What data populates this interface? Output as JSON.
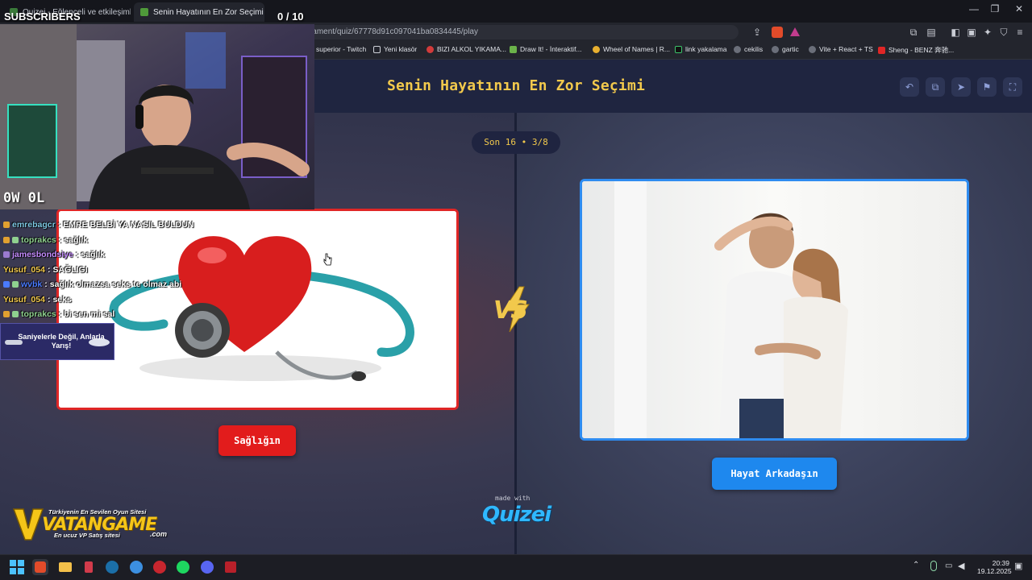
{
  "browser": {
    "tabs": [
      {
        "label": "Quizei - Eğlenceli ve etkileşimli quiz",
        "active": false
      },
      {
        "label": "Senin Hayatının En Zor Seçimi - ",
        "active": true
      }
    ],
    "new_tab": "+",
    "window_controls": {
      "minimize": "—",
      "maximize": "❐",
      "close": "✕"
    },
    "url": "quizei.com/tr/tournament/quiz/67778d91c097041ba0834445/play",
    "bookmarks": [
      "superior - Twitch",
      "Yeni klasör",
      "BIZI ALKOL YIKAMA...",
      "Draw It! - İnteraktif...",
      "Wheel of Names | R...",
      "link yakalama",
      "cekilis",
      "gartic",
      "Vite + React + TS",
      "Sheng - BENZ 奔驰..."
    ]
  },
  "quiz": {
    "title": "Senin Hayatının En Zor Seçimi",
    "round": "Son 16 • 3/8",
    "vs": "VS",
    "left_option": {
      "label": "Sağlığın"
    },
    "right_option": {
      "label": "Hayat Arkadaşın"
    },
    "made_with": "made with",
    "brand": "Quizei",
    "header_icons": [
      "undo-icon",
      "copy-icon",
      "send-icon",
      "flag-icon",
      "fullscreen-icon"
    ]
  },
  "overlay": {
    "subscribers_label": "SUBSCRIBERS",
    "subscribers_count": "0  / 10",
    "channel_tag": "0W 0L",
    "chat": [
      {
        "user": "emrebagcr",
        "user_color": "#7ec8e3",
        "msg": "EMRE BELBİ YA NASIL BULDUN"
      },
      {
        "user": "toprakcs",
        "user_color": "#8fd18f",
        "msg": "sağlık"
      },
      {
        "user": "jamesbondsiye",
        "user_color": "#c58cff",
        "msg": "sağlık"
      },
      {
        "user": "Yusuf_054",
        "user_color": "#f2c94c",
        "msg": "SAĞLIGI"
      },
      {
        "user": "wvbk",
        "user_color": "#4a7bff",
        "msg": "sağlık olmazsa seks te olmaz abi"
      },
      {
        "user": "Yusuf_054",
        "user_color": "#f2c94c",
        "msg": "seks"
      },
      {
        "user": "toprakcs",
        "user_color": "#8fd18f",
        "msg": "bi sen mi sal"
      }
    ],
    "promo": "Saniyelerle Değil, Anlarla Yarış!",
    "sponsor": {
      "tagline": "Türkiyenin En Sevilen Oyun Sitesi",
      "name": "VATANGAME",
      "domain_suffix": ".com",
      "sub": "En ucuz VP Satış sitesi"
    }
  },
  "taskbar": {
    "time": "20:39",
    "date": "19.12.2025"
  }
}
